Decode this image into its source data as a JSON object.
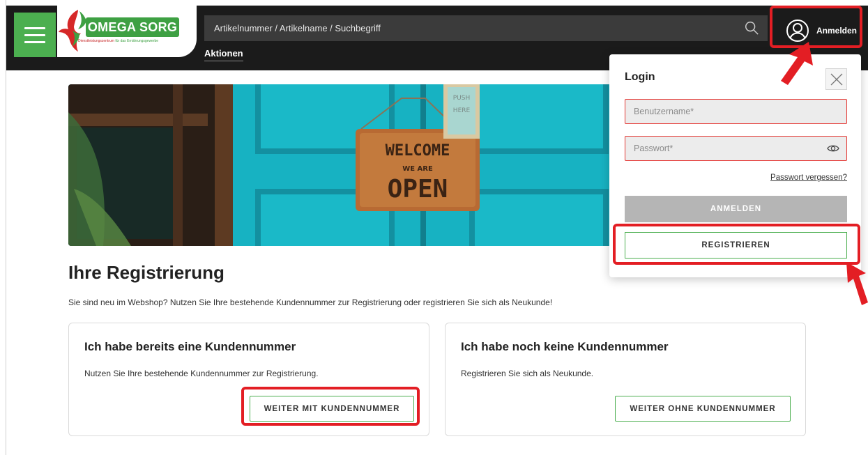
{
  "header": {
    "logo": {
      "brand": "OMEGA SORG",
      "tagline_red": "Dienstleistungszentrum",
      "tagline_green": "für das Ernährungsgewerbe"
    },
    "search": {
      "placeholder": "Artikelnummer / Artikelname / Suchbegriff",
      "icon": "search-icon"
    },
    "nav": {
      "aktionen": "Aktionen"
    },
    "account": {
      "label": "Anmelden",
      "icon": "user-circle-icon"
    }
  },
  "hero": {
    "sign_line1": "WELCOME",
    "sign_line2": "WE ARE",
    "sign_line3": "OPEN",
    "small_sign_line1": "PUSH",
    "small_sign_line2": "HERE"
  },
  "registration": {
    "title": "Ihre Registrierung",
    "intro": "Sie sind neu im Webshop? Nutzen Sie Ihre bestehende Kundennummer zur Registrierung oder registrieren Sie sich als Neukunde!",
    "cards": [
      {
        "title": "Ich habe bereits eine Kundennummer",
        "text": "Nutzen Sie Ihre bestehende Kundennummer zur Registrierung.",
        "button": "WEITER MIT KUNDENNUMMER"
      },
      {
        "title": "Ich habe noch keine Kundennummer",
        "text": "Registrieren Sie sich als Neukunde.",
        "button": "WEITER OHNE KUNDENNUMMER"
      }
    ]
  },
  "login": {
    "title": "Login",
    "username_placeholder": "Benutzername*",
    "password_placeholder": "Passwort*",
    "forgot": "Passwort vergessen?",
    "login_button": "ANMELDEN",
    "register_button": "REGISTRIEREN"
  },
  "colors": {
    "brand_green": "#4caf50",
    "header_bg": "#1b1b1b",
    "highlight_red": "#e31e24",
    "field_error_border": "#e53935"
  }
}
